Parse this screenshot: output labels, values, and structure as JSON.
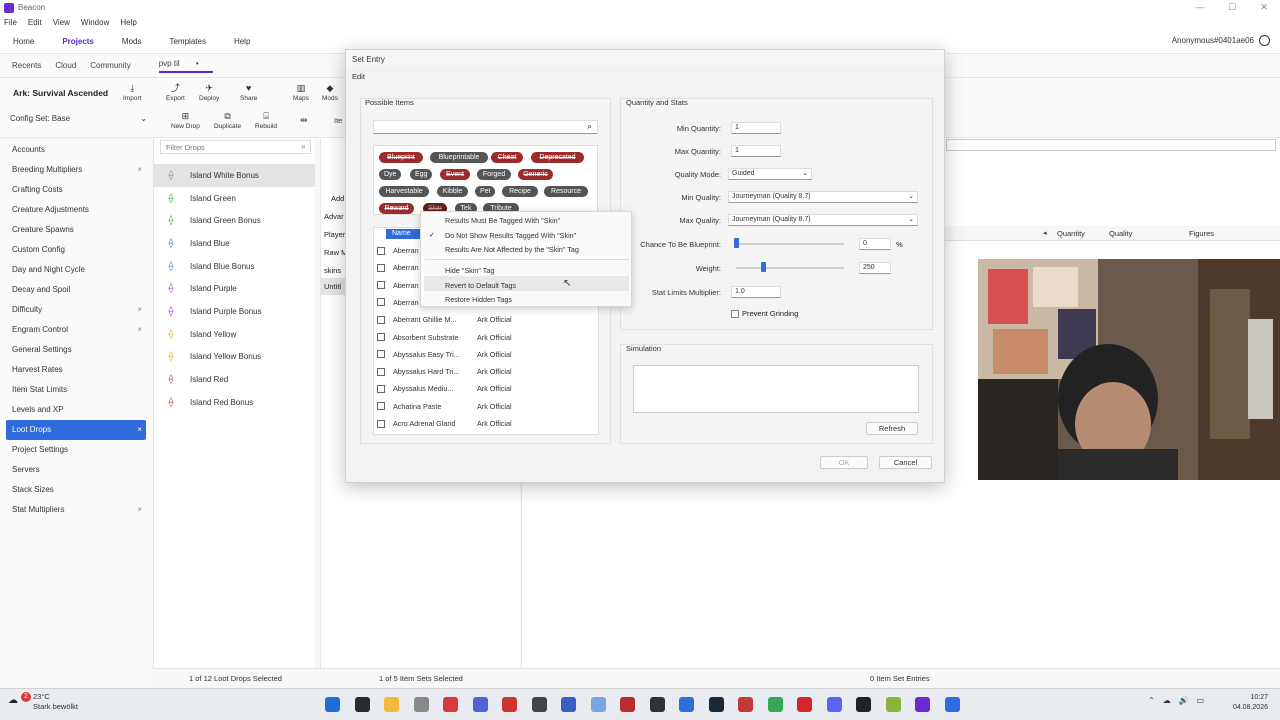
{
  "window": {
    "title": "Beacon",
    "controls": [
      "—",
      "☐",
      "✕"
    ]
  },
  "menu": [
    "File",
    "Edit",
    "View",
    "Window",
    "Help"
  ],
  "nav": {
    "items": [
      "Home",
      "Projects",
      "Mods",
      "Templates",
      "Help"
    ],
    "active": "Projects",
    "account": "Anonymous#0401ae06"
  },
  "subnav": {
    "items": [
      "Recents",
      "Cloud",
      "Community"
    ],
    "project": "pvp til",
    "dot": "•"
  },
  "game_title": "Ark: Survival Ascended",
  "toolbar": {
    "main": [
      {
        "label": "Import",
        "icon": "⤓"
      },
      {
        "label": "Export",
        "icon": "⤴"
      },
      {
        "label": "Deploy",
        "icon": "✈"
      },
      {
        "label": "Share",
        "icon": "♥"
      }
    ],
    "right": [
      {
        "label": "Maps",
        "icon": "▥"
      },
      {
        "label": "Mods",
        "icon": "◆"
      }
    ],
    "drops": [
      {
        "label": "New Drop",
        "icon": "⊞"
      },
      {
        "label": "Duplicate",
        "icon": "⧉"
      },
      {
        "label": "Rebuild",
        "icon": "⌸"
      }
    ],
    "it_label": "Ite"
  },
  "config_set": {
    "label": "Config Set: Base",
    "chevron": "⌄"
  },
  "sidebar": {
    "items": [
      {
        "label": "Accounts",
        "x": ""
      },
      {
        "label": "Breeding Multipliers",
        "x": "×"
      },
      {
        "label": "Crafting Costs",
        "x": ""
      },
      {
        "label": "Creature Adjustments",
        "x": ""
      },
      {
        "label": "Creature Spawns",
        "x": ""
      },
      {
        "label": "Custom Config",
        "x": ""
      },
      {
        "label": "Day and Night Cycle",
        "x": ""
      },
      {
        "label": "Decay and Spoil",
        "x": ""
      },
      {
        "label": "Difficulty",
        "x": "×"
      },
      {
        "label": "Engram Control",
        "x": "×"
      },
      {
        "label": "General Settings",
        "x": ""
      },
      {
        "label": "Harvest Rates",
        "x": ""
      },
      {
        "label": "Item Stat Limits",
        "x": ""
      },
      {
        "label": "Levels and XP",
        "x": ""
      },
      {
        "label": "Loot Drops",
        "x": "×",
        "active": true
      },
      {
        "label": "Project Settings",
        "x": ""
      },
      {
        "label": "Servers",
        "x": ""
      },
      {
        "label": "Stack Sizes",
        "x": ""
      },
      {
        "label": "Stat Multipliers",
        "x": "×"
      }
    ]
  },
  "drops": {
    "filter_placeholder": "Filter Drops",
    "items": [
      {
        "label": "Island White Bonus",
        "color": "#888888"
      },
      {
        "label": "Island Green",
        "color": "#3fa33f"
      },
      {
        "label": "Island Green Bonus",
        "color": "#3fa33f"
      },
      {
        "label": "Island Blue",
        "color": "#3a7fd6"
      },
      {
        "label": "Island Blue Bonus",
        "color": "#3a7fd6"
      },
      {
        "label": "Island Purple",
        "color": "#9b3fd1"
      },
      {
        "label": "Island Purple Bonus",
        "color": "#9b3fd1"
      },
      {
        "label": "Island Yellow",
        "color": "#c9b21f"
      },
      {
        "label": "Island Yellow Bonus",
        "color": "#c9b21f"
      },
      {
        "label": "Island Red",
        "color": "#d43c3c"
      },
      {
        "label": "Island Red Bonus",
        "color": "#d43c3c"
      }
    ]
  },
  "mid_fragments": [
    "Add",
    "Advar",
    "Player",
    "Raw M",
    "skins",
    "Untitl"
  ],
  "right_headers": {
    "quantity": "Quantity",
    "quality": "Quality",
    "figures": "Figures",
    "arrow": "◂"
  },
  "status": {
    "drops": "1 of 12 Loot Drops Selected",
    "sets": "1 of 5 Item Sets Selected",
    "entries": "0 Item Set Entries"
  },
  "dialog": {
    "title": "Set Entry",
    "menu": "Edit",
    "possible_items": "Possible Items",
    "tags": [
      {
        "label": "Blueprint",
        "style": "red"
      },
      {
        "label": "Blueprintable",
        "style": "grey"
      },
      {
        "label": "Cheat",
        "style": "red"
      },
      {
        "label": "Deprecated",
        "style": "red"
      },
      {
        "label": "Dye",
        "style": "grey"
      },
      {
        "label": "Egg",
        "style": "grey"
      },
      {
        "label": "Event",
        "style": "red"
      },
      {
        "label": "Forged",
        "style": "grey"
      },
      {
        "label": "Generic",
        "style": "red"
      },
      {
        "label": "Harvestable",
        "style": "grey"
      },
      {
        "label": "Kibble",
        "style": "grey"
      },
      {
        "label": "Pet",
        "style": "grey"
      },
      {
        "label": "Recipe",
        "style": "grey"
      },
      {
        "label": "Resource",
        "style": "grey"
      },
      {
        "label": "Reward",
        "style": "red"
      },
      {
        "label": "Skin",
        "style": "selected"
      },
      {
        "label": "Tek",
        "style": "grey"
      },
      {
        "label": "Tribute",
        "style": "grey"
      }
    ],
    "list_header": {
      "name": "Name"
    },
    "list_items": [
      {
        "name": "Aberran",
        "mod": ""
      },
      {
        "name": "Aberran",
        "mod": ""
      },
      {
        "name": "Aberran",
        "mod": ""
      },
      {
        "name": "Aberran",
        "mod": ""
      },
      {
        "name": "Aberrant Ghillie M...",
        "mod": "Ark Official"
      },
      {
        "name": "Absorbent Substrate",
        "mod": "Ark Official"
      },
      {
        "name": "Abyssalus Easy Tri...",
        "mod": "Ark Official"
      },
      {
        "name": "Abyssalus Hard Tri...",
        "mod": "Ark Official"
      },
      {
        "name": "Abyssalus Mediu...",
        "mod": "Ark Official"
      },
      {
        "name": "Achatina Paste",
        "mod": "Ark Official"
      },
      {
        "name": "Acro Adrenal Gland",
        "mod": "Ark Official"
      }
    ],
    "context_menu": [
      {
        "label": "Results Must Be Tagged With \"Skin\"",
        "check": ""
      },
      {
        "label": "Do Not Show Results Tagged With \"Skin\"",
        "check": "✓"
      },
      {
        "label": "Results Are Not Affected by the \"Skin\" Tag",
        "check": ""
      },
      {
        "label": "Hide \"Skin\" Tag",
        "check": ""
      },
      {
        "label": "Revert to Default Tags",
        "check": ""
      },
      {
        "label": "Restore Hidden Tags",
        "check": ""
      }
    ],
    "qs": {
      "title": "Quantity and Stats",
      "min_qty_label": "Min Quantity:",
      "min_qty": "1",
      "max_qty_label": "Max Quantity:",
      "max_qty": "1",
      "quality_mode_label": "Quality Mode:",
      "quality_mode": "Guided",
      "min_quality_label": "Min Quality:",
      "min_quality": "Journeyman (Quality 8.7)",
      "max_quality_label": "Max Quality:",
      "max_quality": "Journeyman (Quality 8.7)",
      "bp_label": "Chance To Be Blueprint:",
      "bp_value": "0",
      "bp_unit": "%",
      "bp_fraction": 0,
      "weight_label": "Weight:",
      "weight_value": "250",
      "weight_fraction": 0.25,
      "stat_label": "Stat Limits Multiplier:",
      "stat_value": "1.0",
      "prevent_grinding": "Prevent Grinding"
    },
    "simulation": {
      "title": "Simulation",
      "refresh": "Refresh"
    },
    "ok": "OK",
    "cancel": "Cancel"
  },
  "taskbar": {
    "weather_temp": "23°C",
    "weather_desc": "Stark bewölkt",
    "badge": "2",
    "time": "10:27",
    "date": "04.08.2026",
    "icons": [
      {
        "name": "windows-start",
        "color": "#1e6fd9"
      },
      {
        "name": "search",
        "color": "#2b2b2b"
      },
      {
        "name": "file-explorer",
        "color": "#f2b93b"
      },
      {
        "name": "mouse-app",
        "color": "#888888"
      },
      {
        "name": "app-red",
        "color": "#d83b3b"
      },
      {
        "name": "app-v",
        "color": "#5063d6"
      },
      {
        "name": "app-record",
        "color": "#d03434"
      },
      {
        "name": "app-circle",
        "color": "#444444"
      },
      {
        "name": "app-blue",
        "color": "#3a5fc8"
      },
      {
        "name": "app-gear",
        "color": "#7aa6e6"
      },
      {
        "name": "app-box",
        "color": "#b82e2e"
      },
      {
        "name": "app-mask",
        "color": "#333333"
      },
      {
        "name": "app-blue2",
        "color": "#2f6fd9"
      },
      {
        "name": "steam",
        "color": "#1b2838"
      },
      {
        "name": "app-red2",
        "color": "#c43a3a"
      },
      {
        "name": "chrome",
        "color": "#3aa757"
      },
      {
        "name": "opera",
        "color": "#d4262c"
      },
      {
        "name": "discord",
        "color": "#5865f2"
      },
      {
        "name": "app-dark",
        "color": "#222222"
      },
      {
        "name": "app-green",
        "color": "#8bb33a"
      },
      {
        "name": "beacon",
        "color": "#6b2bd1"
      },
      {
        "name": "app-ark",
        "color": "#2f6bdc"
      }
    ],
    "tray": [
      "⌃",
      "☁",
      "🔊",
      "▭"
    ]
  }
}
